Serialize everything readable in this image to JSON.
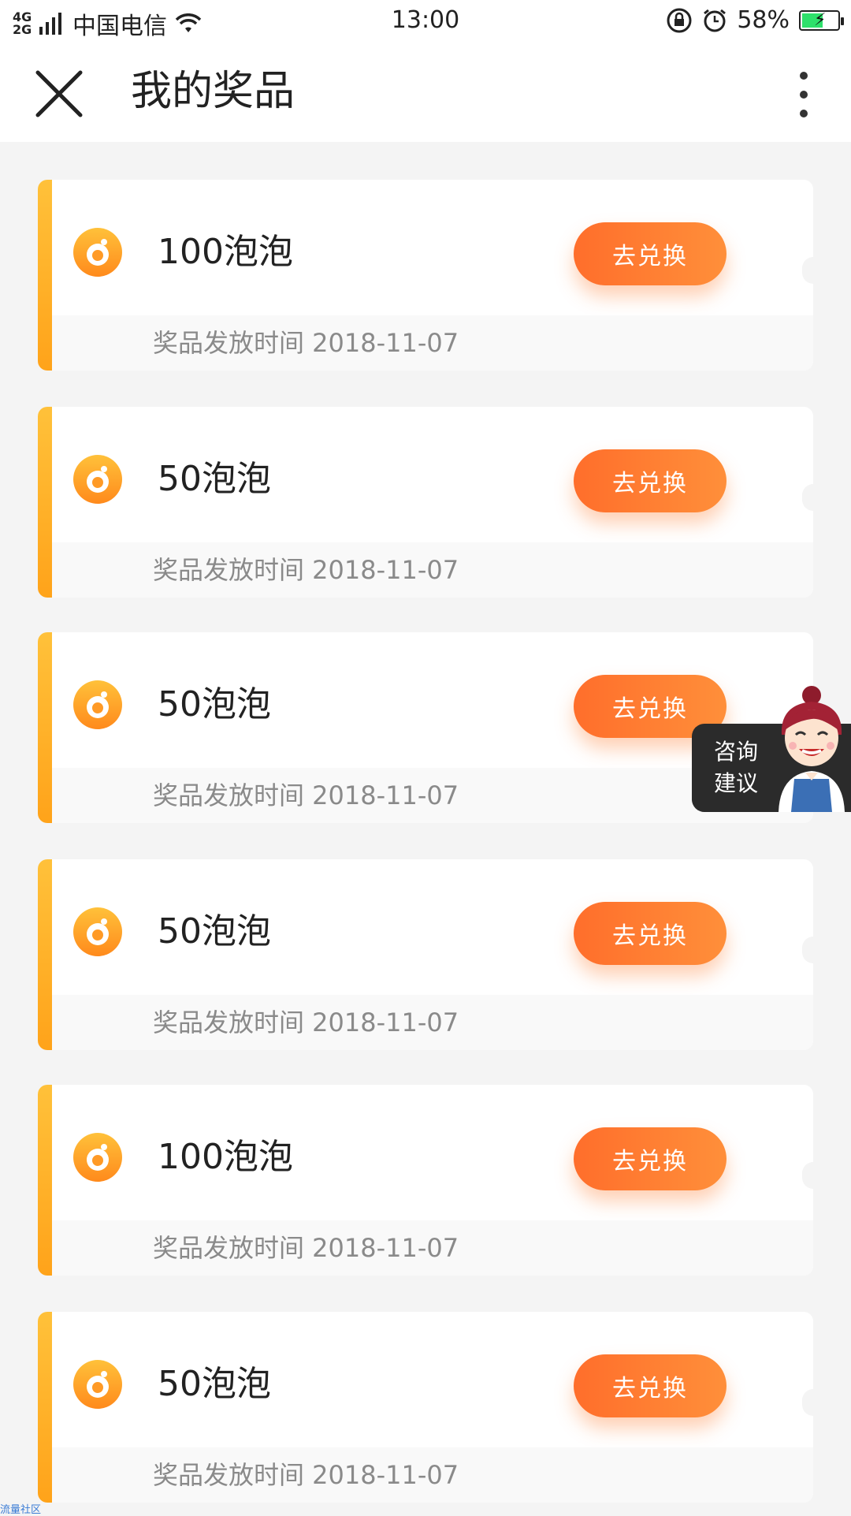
{
  "status_bar": {
    "network": "4G+ 2G",
    "carrier": "中国电信",
    "time": "13:00",
    "battery_text": "58%",
    "battery_level": 0.58
  },
  "header": {
    "title": "我的奖品"
  },
  "prizes": [
    {
      "name": "100泡泡",
      "button": "去兑换",
      "date": "奖品发放时间 2018-11-07"
    },
    {
      "name": "50泡泡",
      "button": "去兑换",
      "date": "奖品发放时间 2018-11-07"
    },
    {
      "name": "50泡泡",
      "button": "去兑换",
      "date": "奖品发放时间 2018-11-07"
    },
    {
      "name": "50泡泡",
      "button": "去兑换",
      "date": "奖品发放时间 2018-11-07"
    },
    {
      "name": "100泡泡",
      "button": "去兑换",
      "date": "奖品发放时间 2018-11-07"
    },
    {
      "name": "50泡泡",
      "button": "去兑换",
      "date": "奖品发放时间 2018-11-07"
    }
  ],
  "consult": {
    "line1": "咨询",
    "line2": "建议"
  },
  "watermark": "流量社区",
  "colors": {
    "accent": "#ff7a30",
    "stripe": "#ffb020",
    "background": "#f4f4f4"
  },
  "icons": {
    "close": "close-icon",
    "more": "more-vertical-icon",
    "prize": "bubble-coin-icon"
  }
}
